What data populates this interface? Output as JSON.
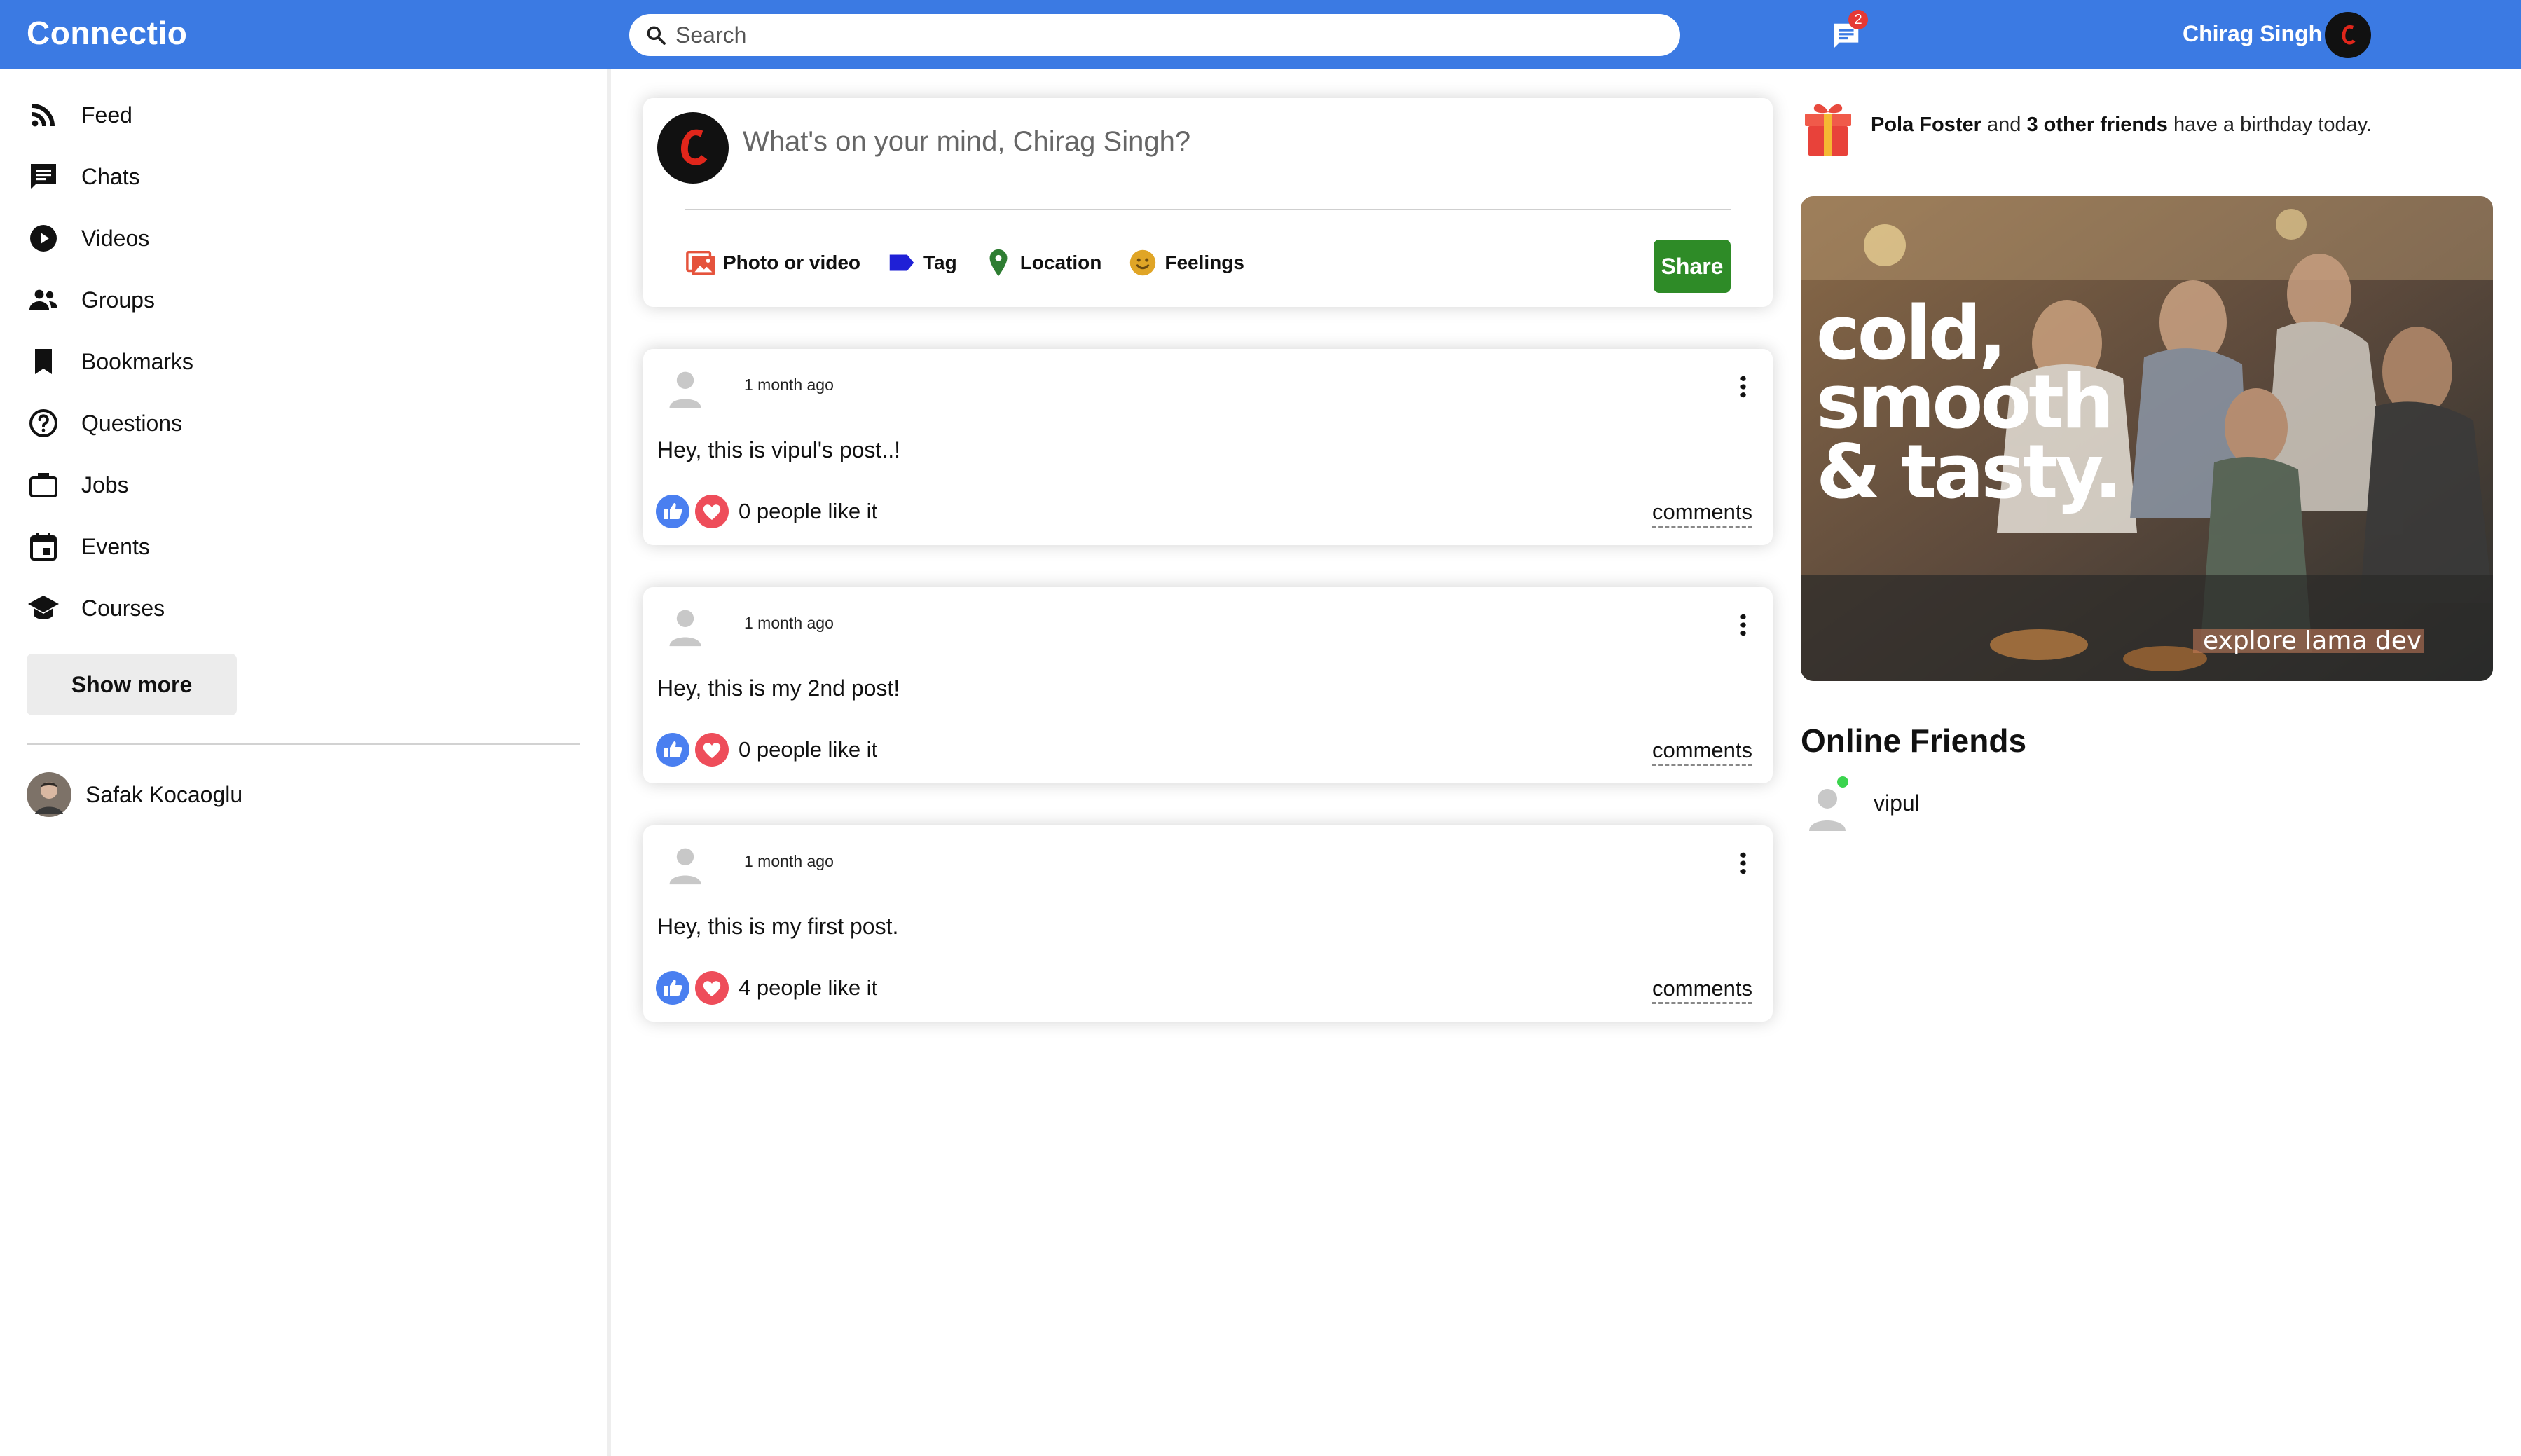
{
  "app": {
    "logo": "Connectio"
  },
  "topbar": {
    "search_placeholder": "Search",
    "notification_count": "2",
    "username": "Chirag Singh"
  },
  "sidebar": {
    "items": [
      {
        "label": "Feed",
        "icon": "rss-feed-icon"
      },
      {
        "label": "Chats",
        "icon": "chat-icon"
      },
      {
        "label": "Videos",
        "icon": "play-circle-icon"
      },
      {
        "label": "Groups",
        "icon": "group-icon"
      },
      {
        "label": "Bookmarks",
        "icon": "bookmark-icon"
      },
      {
        "label": "Questions",
        "icon": "help-circle-icon"
      },
      {
        "label": "Jobs",
        "icon": "work-icon"
      },
      {
        "label": "Events",
        "icon": "calendar-icon"
      },
      {
        "label": "Courses",
        "icon": "school-icon"
      }
    ],
    "show_more": "Show more",
    "friends": [
      {
        "name": "Safak Kocaoglu"
      }
    ]
  },
  "share": {
    "placeholder": "What's on your mind, Chirag Singh?",
    "options": [
      {
        "label": "Photo or video",
        "icon": "photo-icon",
        "color": "#e5533c"
      },
      {
        "label": "Tag",
        "icon": "label-icon",
        "color": "#1f20d6"
      },
      {
        "label": "Location",
        "icon": "location-pin-icon",
        "color": "#2e7d32"
      },
      {
        "label": "Feelings",
        "icon": "emoji-icon",
        "color": "#e0a526"
      }
    ],
    "button": "Share",
    "button_color": "#2e8b27"
  },
  "posts": [
    {
      "time": "1 month ago",
      "text": "Hey, this is vipul's post..!",
      "likes": "0 people like it",
      "comments": "comments"
    },
    {
      "time": "1 month ago",
      "text": "Hey, this is my 2nd post!",
      "likes": "0 people like it",
      "comments": "comments"
    },
    {
      "time": "1 month ago",
      "text": "Hey, this is my first post.",
      "likes": "4 people like it",
      "comments": "comments"
    }
  ],
  "rightbar": {
    "birthday": {
      "name": "Pola Foster",
      "mid": "and",
      "others": "3 other friends",
      "suffix": "have a birthday today."
    },
    "ad": {
      "line1": "cold,",
      "line2": "smooth",
      "line3": "& tasty.",
      "footer": "explore lama dev"
    },
    "online_title": "Online Friends",
    "online_friends": [
      {
        "name": "vipul",
        "status_color": "#3bd44e"
      }
    ]
  },
  "colors": {
    "brand": "#3b7ae3",
    "like": "#4a7ff0",
    "heart": "#ee4d5a"
  }
}
